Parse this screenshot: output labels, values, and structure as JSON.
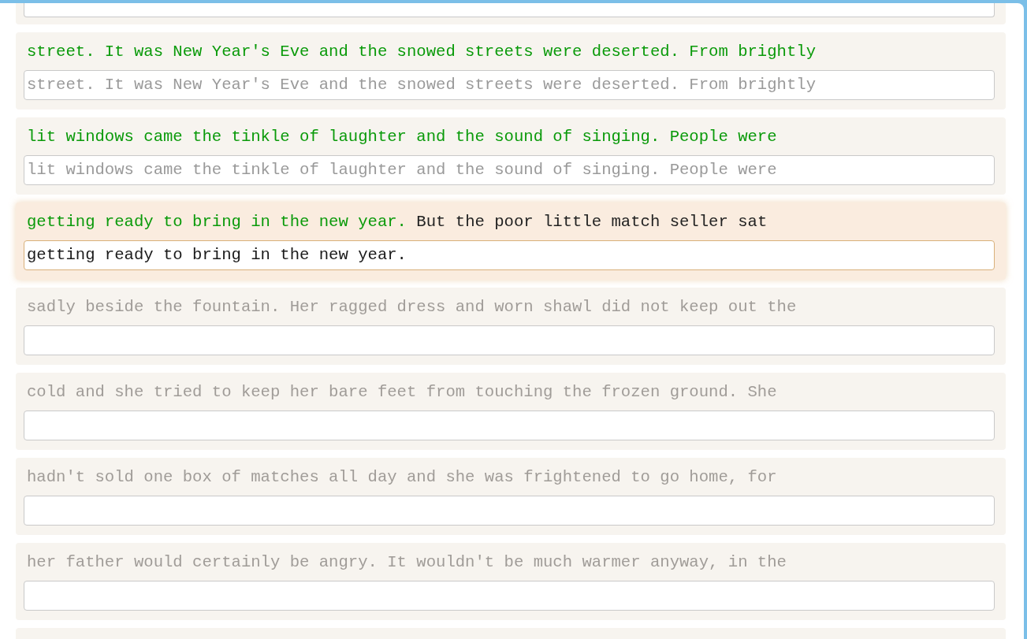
{
  "lines": [
    {
      "done": "street. It was New Year's Eve and the snowed streets were deserted. From brightly",
      "typed": "street. It was New Year's Eve and the snowed streets were deserted. From brightly",
      "active": false
    },
    {
      "done": "lit windows came the tinkle of laughter and the sound of singing. People were",
      "typed": "lit windows came the tinkle of laughter and the sound of singing. People were",
      "active": false
    },
    {
      "done": "getting ready to bring in the new year.",
      "rest": " But the poor little match seller sat",
      "typed": "getting ready to bring in the new year.",
      "active": true
    },
    {
      "rest": "sadly beside the fountain. Her ragged dress and worn shawl did not keep out the",
      "active": false
    },
    {
      "rest": "cold and she tried to keep her bare feet from touching the frozen ground. She",
      "active": false
    },
    {
      "rest": "hadn't sold one box of matches all day and she was frightened to go home, for",
      "active": false
    },
    {
      "rest": "her father would certainly be angry. It wouldn't be much warmer anyway, in the",
      "active": false
    }
  ]
}
